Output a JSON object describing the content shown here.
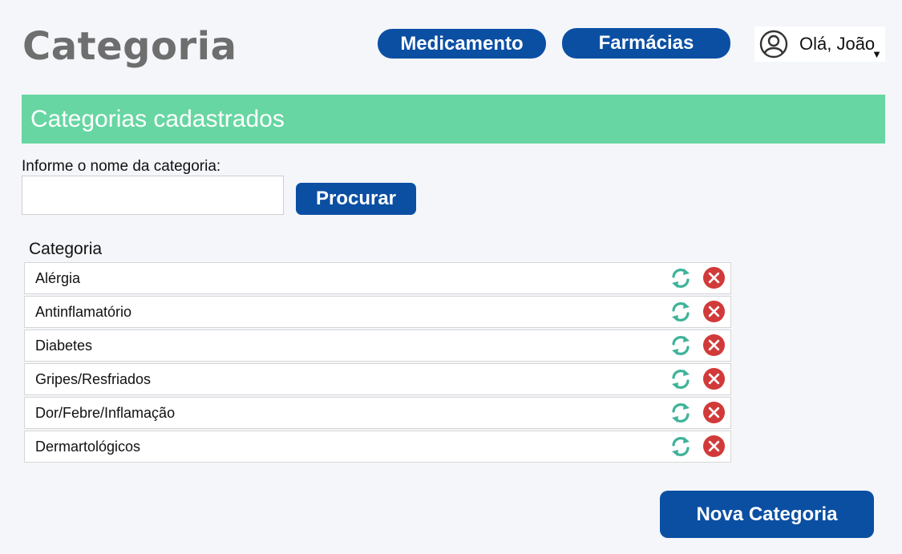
{
  "page": {
    "title": "Categoria"
  },
  "nav": {
    "items": [
      {
        "label": "Medicamento"
      },
      {
        "label": "Farmácias"
      }
    ]
  },
  "user": {
    "greeting": "Olá, João",
    "caret": "▼",
    "avatar_icon": "user-circle-icon"
  },
  "section": {
    "title": "Categorias cadastrados"
  },
  "search": {
    "label": "Informe o nome da categoria:",
    "value": "",
    "placeholder": "",
    "button_label": "Procurar"
  },
  "list": {
    "header": "Categoria",
    "refresh_icon": "refresh-icon",
    "delete_icon": "delete-icon",
    "items": [
      {
        "name": "Alérgia"
      },
      {
        "name": "Antinflamatório"
      },
      {
        "name": "Diabetes"
      },
      {
        "name": "Gripes/Resfriados"
      },
      {
        "name": "Dor/Febre/Inflamação"
      },
      {
        "name": "Dermartológicos"
      }
    ]
  },
  "actions": {
    "new_label": "Nova Categoria"
  },
  "colors": {
    "primary": "#0b4fa3",
    "banner": "#67d6a2",
    "refresh": "#3fb39a",
    "delete": "#d23a3a",
    "title_gray": "#6e6e6e",
    "background": "#f4f6fa"
  }
}
